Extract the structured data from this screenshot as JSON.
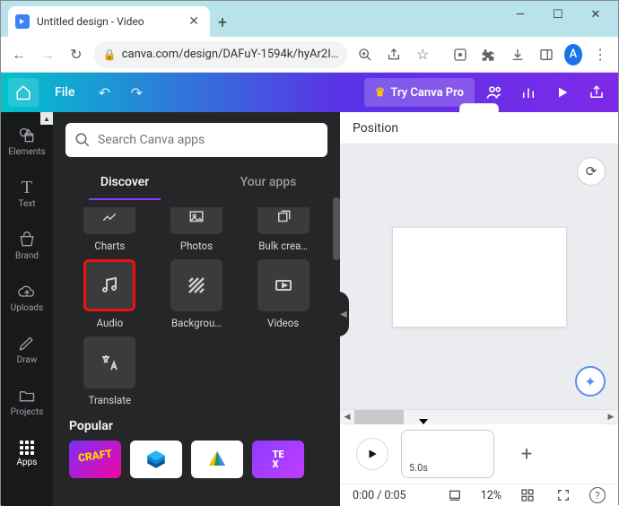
{
  "window": {
    "tab_title": "Untitled design - Video"
  },
  "browser": {
    "url": "canva.com/design/DAFuY-1594k/hyAr2I…",
    "avatar_initial": "A"
  },
  "canva_bar": {
    "file": "File",
    "try_pro": "Try Canva Pro"
  },
  "rail": {
    "elements": "Elements",
    "text": "Text",
    "brand": "Brand",
    "uploads": "Uploads",
    "draw": "Draw",
    "projects": "Projects",
    "apps": "Apps"
  },
  "panel": {
    "search_placeholder": "Search Canva apps",
    "tab_discover": "Discover",
    "tab_your_apps": "Your apps",
    "cards": {
      "charts": "Charts",
      "photos": "Photos",
      "bulk": "Bulk crea…",
      "audio": "Audio",
      "backgrounds": "Backgrou…",
      "videos": "Videos",
      "translate": "Translate"
    },
    "popular_heading": "Popular"
  },
  "canvas": {
    "position": "Position"
  },
  "timeline": {
    "clip_duration": "5.0s",
    "time": "0:00 / 0:05",
    "zoom": "12%"
  }
}
